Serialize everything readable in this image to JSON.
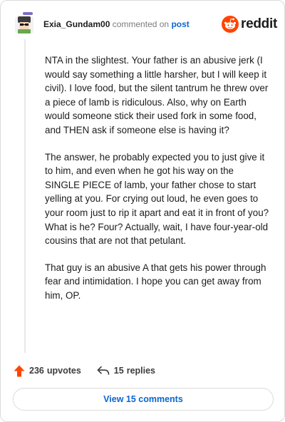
{
  "header": {
    "username": "Exia_Gundam00",
    "action_text": "commented on",
    "post_link": "post",
    "brand": "reddit"
  },
  "comment": {
    "paragraphs": [
      "NTA in the slightest. Your father is an abusive jerk (I would say something a little harsher, but I will keep it civil). I love food, but the silent tantrum he threw over a piece of lamb is ridiculous. Also, why on Earth would someone stick their used fork in some food, and THEN ask if someone else is having it?",
      "The answer, he probably expected you to just give it to him, and even when he got his way on the SINGLE PIECE of lamb, your father chose to start yelling at you. For crying out loud, he even goes to your room just to rip it apart and eat it in front of you? What is he? Four? Actually, wait, I have four-year-old cousins that are not that petulant.",
      "That guy is an abusive A that gets his power through fear and intimidation. I hope you can get away from him, OP."
    ]
  },
  "actions": {
    "upvotes_count": "236",
    "upvotes_label": "upvotes",
    "replies_count": "15",
    "replies_label": "replies"
  },
  "footer": {
    "view_comments_label": "View 15 comments"
  },
  "colors": {
    "accent_blue": "#0a66d1",
    "upvote_orange": "#ff4500",
    "avatar_ring": "#7b6cc9"
  },
  "icons": {
    "upvote": "arrow-up-icon",
    "reply": "reply-arrow-icon",
    "brand": "reddit-snoo-icon"
  }
}
